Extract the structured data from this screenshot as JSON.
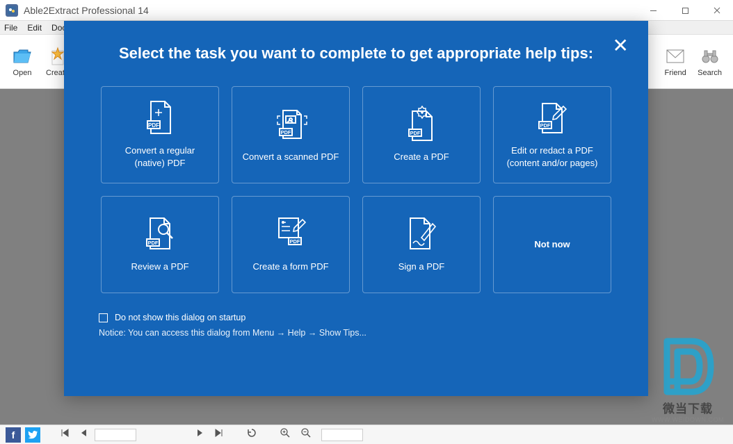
{
  "window": {
    "title": "Able2Extract Professional 14"
  },
  "menu": {
    "file": "File",
    "edit": "Edit",
    "document": "Docu"
  },
  "toolbar": {
    "open": "Open",
    "create": "Create",
    "friend": "Friend",
    "search": "Search"
  },
  "modal": {
    "heading": "Select the task you want to complete to get appropriate help tips:",
    "cards": {
      "convert_native": "Convert a regular (native) PDF",
      "convert_scanned": "Convert a scanned PDF",
      "create_pdf": "Create a PDF",
      "edit_redact": "Edit or redact a PDF (content and/or pages)",
      "review": "Review a PDF",
      "create_form": "Create a form PDF",
      "sign": "Sign a PDF",
      "not_now": "Not now"
    },
    "checkbox_label": "Do not show this dialog on startup",
    "notice": "Notice: You can access this dialog from Menu → Help → Show Tips..."
  },
  "watermark": {
    "text": "微当下载",
    "url": "WWW.WEIDOWN.COM"
  }
}
